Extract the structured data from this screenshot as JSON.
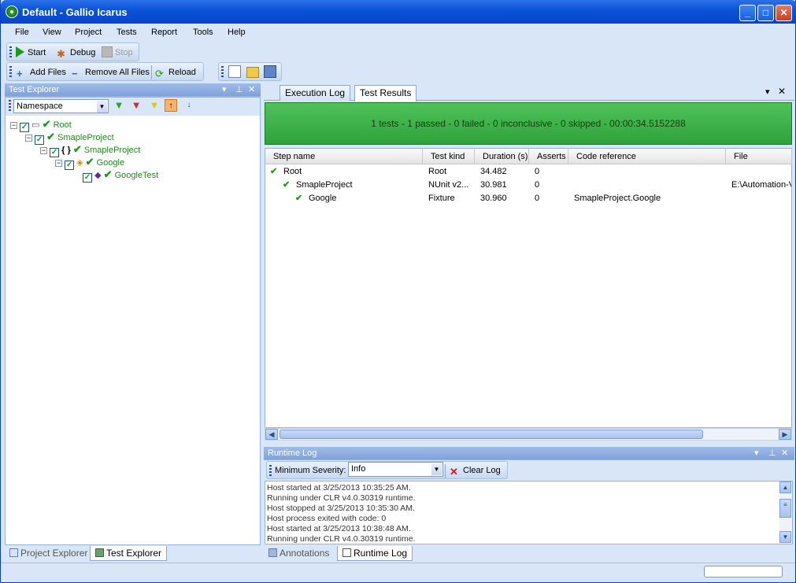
{
  "window": {
    "title": "Default - Gallio Icarus"
  },
  "menu": [
    "File",
    "View",
    "Project",
    "Tests",
    "Report",
    "Tools",
    "Help"
  ],
  "run_toolbar": {
    "start": "Start",
    "debug": "Debug",
    "stop": "Stop"
  },
  "file_toolbar": {
    "add_files": "Add Files",
    "remove_all": "Remove All Files",
    "reload": "Reload"
  },
  "explorer": {
    "title": "Test Explorer",
    "group_by": "Namespace",
    "tree": [
      {
        "label": "Root"
      },
      {
        "label": "SmapleProject"
      },
      {
        "label": "SmapleProject"
      },
      {
        "label": "Google"
      },
      {
        "label": "GoogleTest"
      }
    ]
  },
  "right_tabs": [
    "Execution Log",
    "Test Results"
  ],
  "results": {
    "summary": "1 tests - 1 passed - 0 failed - 0 inconclusive - 0 skipped - 00:00:34.5152288",
    "columns": [
      "Step name",
      "Test kind",
      "Duration (s)",
      "Asserts",
      "Code reference",
      "File"
    ],
    "rows": [
      {
        "name": "Root",
        "kind": "Root",
        "duration": "34.482",
        "asserts": "0",
        "code_ref": "",
        "file": ""
      },
      {
        "name": "SmapleProject",
        "kind": "NUnit v2...",
        "duration": "30.981",
        "asserts": "0",
        "code_ref": "",
        "file": "E:\\Automation-V"
      },
      {
        "name": "Google",
        "kind": "Fixture",
        "duration": "30.960",
        "asserts": "0",
        "code_ref": "SmapleProject.Google",
        "file": ""
      }
    ]
  },
  "runtime_log": {
    "title": "Runtime Log",
    "severity_label": "Minimum Severity:",
    "severity_value": "Info",
    "clear_label": "Clear Log",
    "lines": [
      "Host started at 3/25/2013 10:35:25 AM.",
      "Running under CLR v4.0.30319 runtime.",
      "Host stopped at 3/25/2013 10:35:30 AM.",
      "Host process exited with code: 0",
      "Host started at 3/25/2013 10:38:48 AM.",
      "Running under CLR v4.0.30319 runtime."
    ]
  },
  "left_bottom_tabs": [
    "Project Explorer",
    "Test Explorer"
  ],
  "right_bottom_tabs": [
    "Annotations",
    "Runtime Log"
  ],
  "colors": {
    "pass_green": "#2fa23b",
    "title_blue": "#0a52d8"
  }
}
